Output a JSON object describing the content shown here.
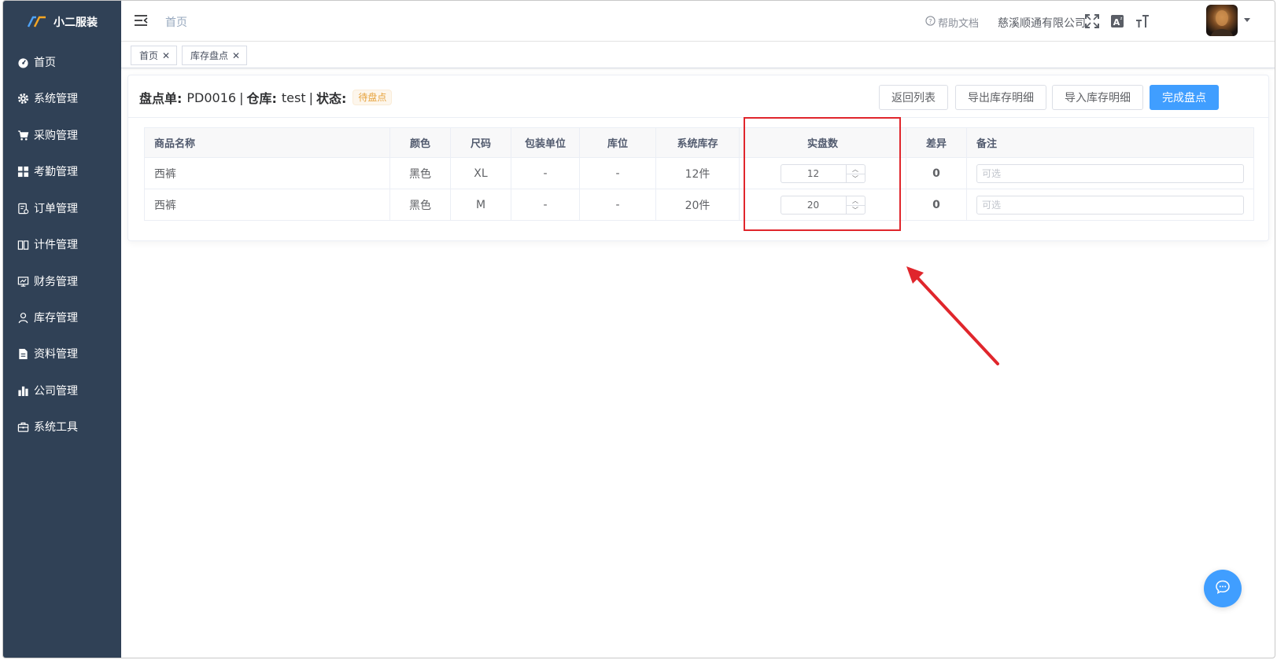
{
  "app": {
    "name": "小二服装"
  },
  "sidebar": {
    "items": [
      {
        "label": "首页",
        "icon": "dashboard-icon"
      },
      {
        "label": "系统管理",
        "icon": "gear-icon"
      },
      {
        "label": "采购管理",
        "icon": "cart-icon"
      },
      {
        "label": "考勤管理",
        "icon": "grid-icon"
      },
      {
        "label": "订单管理",
        "icon": "order-icon"
      },
      {
        "label": "计件管理",
        "icon": "book-icon"
      },
      {
        "label": "财务管理",
        "icon": "chart-monitor-icon"
      },
      {
        "label": "库存管理",
        "icon": "user-icon"
      },
      {
        "label": "资料管理",
        "icon": "document-icon"
      },
      {
        "label": "公司管理",
        "icon": "bar-chart-icon"
      },
      {
        "label": "系统工具",
        "icon": "toolbox-icon"
      }
    ]
  },
  "header": {
    "breadcrumb": "首页",
    "help_label": "帮助文档",
    "company": "慈溪顺通有限公司"
  },
  "tags": [
    {
      "label": "首页"
    },
    {
      "label": "库存盘点"
    }
  ],
  "order": {
    "no_label": "盘点单:",
    "no_value": "PD0016",
    "warehouse_label": "仓库:",
    "warehouse_value": "test",
    "status_label": "状态:",
    "status_value": "待盘点",
    "status_color": "#e6a23c",
    "divider": "|"
  },
  "actions": {
    "back": "返回列表",
    "export": "导出库存明细",
    "import": "导入库存明细",
    "complete": "完成盘点"
  },
  "table": {
    "headers": [
      "商品名称",
      "颜色",
      "尺码",
      "包装单位",
      "库位",
      "系统库存",
      "实盘数",
      "差异",
      "备注"
    ],
    "rows": [
      {
        "name": "西裤",
        "color": "黑色",
        "size": "XL",
        "unit": "-",
        "location": "-",
        "system_stock": "12件",
        "actual": "12",
        "diff": "0",
        "remark_placeholder": "可选"
      },
      {
        "name": "西裤",
        "color": "黑色",
        "size": "M",
        "unit": "-",
        "location": "-",
        "system_stock": "20件",
        "actual": "20",
        "diff": "0",
        "remark_placeholder": "可选"
      }
    ]
  },
  "colors": {
    "sidebar_bg": "#304156",
    "primary": "#409eff",
    "annotation": "#e0262c"
  }
}
